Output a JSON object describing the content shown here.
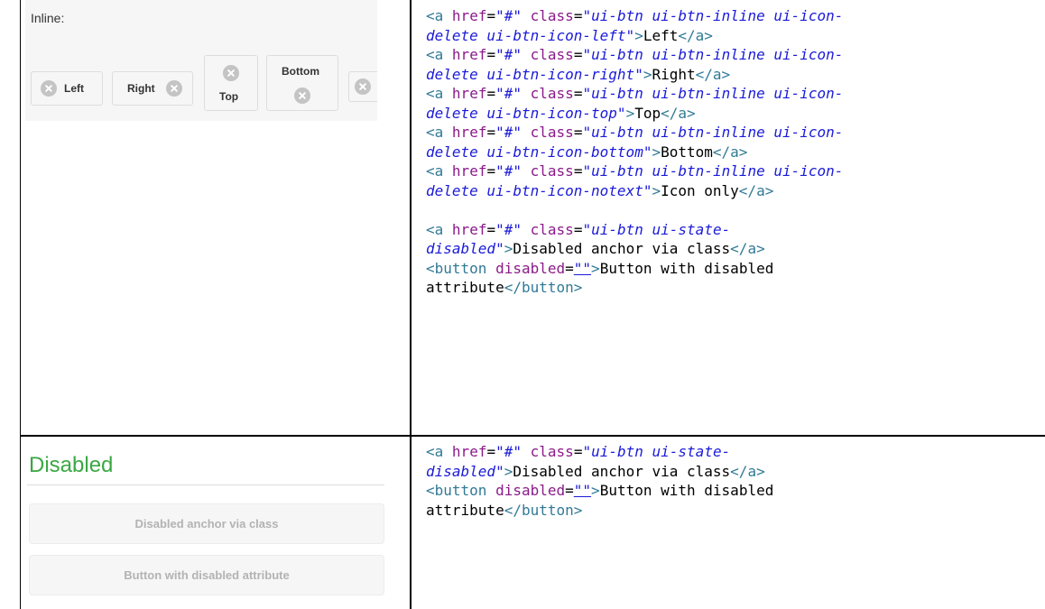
{
  "inline_demo": {
    "label": "Inline:",
    "buttons": {
      "left": "Left",
      "right": "Right",
      "top": "Top",
      "bottom": "Bottom"
    }
  },
  "disabled_demo": {
    "title": "Disabled",
    "anchor_label": "Disabled anchor via class",
    "button_label": "Button with disabled attribute"
  },
  "code_1": {
    "lines": [
      [
        [
          "t",
          "<"
        ],
        [
          "t",
          "a"
        ],
        [
          "x",
          " "
        ],
        [
          "a",
          "href"
        ],
        [
          "x",
          "="
        ],
        [
          "s",
          "\"#\""
        ],
        [
          "x",
          " "
        ],
        [
          "a",
          "class"
        ],
        [
          "x",
          "="
        ],
        [
          "s",
          "\"ui-btn ui-btn-inline ui-icon-"
        ]
      ],
      [
        [
          "s",
          "delete ui-btn-icon-left\""
        ],
        [
          "t",
          ">"
        ],
        [
          "x",
          "Left"
        ],
        [
          "t",
          "</a>"
        ]
      ],
      [
        [
          "t",
          "<"
        ],
        [
          "t",
          "a"
        ],
        [
          "x",
          " "
        ],
        [
          "a",
          "href"
        ],
        [
          "x",
          "="
        ],
        [
          "s",
          "\"#\""
        ],
        [
          "x",
          " "
        ],
        [
          "a",
          "class"
        ],
        [
          "x",
          "="
        ],
        [
          "s",
          "\"ui-btn ui-btn-inline ui-icon-"
        ]
      ],
      [
        [
          "s",
          "delete ui-btn-icon-right\""
        ],
        [
          "t",
          ">"
        ],
        [
          "x",
          "Right"
        ],
        [
          "t",
          "</a>"
        ]
      ],
      [
        [
          "t",
          "<"
        ],
        [
          "t",
          "a"
        ],
        [
          "x",
          " "
        ],
        [
          "a",
          "href"
        ],
        [
          "x",
          "="
        ],
        [
          "s",
          "\"#\""
        ],
        [
          "x",
          " "
        ],
        [
          "a",
          "class"
        ],
        [
          "x",
          "="
        ],
        [
          "s",
          "\"ui-btn ui-btn-inline ui-icon-"
        ]
      ],
      [
        [
          "s",
          "delete ui-btn-icon-top\""
        ],
        [
          "t",
          ">"
        ],
        [
          "x",
          "Top"
        ],
        [
          "t",
          "</a>"
        ]
      ],
      [
        [
          "t",
          "<"
        ],
        [
          "t",
          "a"
        ],
        [
          "x",
          " "
        ],
        [
          "a",
          "href"
        ],
        [
          "x",
          "="
        ],
        [
          "s",
          "\"#\""
        ],
        [
          "x",
          " "
        ],
        [
          "a",
          "class"
        ],
        [
          "x",
          "="
        ],
        [
          "s",
          "\"ui-btn ui-btn-inline ui-icon-"
        ]
      ],
      [
        [
          "s",
          "delete ui-btn-icon-bottom\""
        ],
        [
          "t",
          ">"
        ],
        [
          "x",
          "Bottom"
        ],
        [
          "t",
          "</a>"
        ]
      ],
      [
        [
          "t",
          "<"
        ],
        [
          "t",
          "a"
        ],
        [
          "x",
          " "
        ],
        [
          "a",
          "href"
        ],
        [
          "x",
          "="
        ],
        [
          "s",
          "\"#\""
        ],
        [
          "x",
          " "
        ],
        [
          "a",
          "class"
        ],
        [
          "x",
          "="
        ],
        [
          "s",
          "\"ui-btn ui-btn-inline ui-icon-"
        ]
      ],
      [
        [
          "s",
          "delete ui-btn-icon-notext\""
        ],
        [
          "t",
          ">"
        ],
        [
          "x",
          "Icon only"
        ],
        [
          "t",
          "</a>"
        ]
      ],
      [],
      [
        [
          "t",
          "<"
        ],
        [
          "t",
          "a"
        ],
        [
          "x",
          " "
        ],
        [
          "a",
          "href"
        ],
        [
          "x",
          "="
        ],
        [
          "s",
          "\"#\""
        ],
        [
          "x",
          " "
        ],
        [
          "a",
          "class"
        ],
        [
          "x",
          "="
        ],
        [
          "s",
          "\"ui-btn ui-state-"
        ]
      ],
      [
        [
          "s",
          "disabled\""
        ],
        [
          "t",
          ">"
        ],
        [
          "x",
          "Disabled anchor via class"
        ],
        [
          "t",
          "</a>"
        ]
      ],
      [
        [
          "t",
          "<button"
        ],
        [
          "x",
          " "
        ],
        [
          "a",
          "disabled"
        ],
        [
          "x",
          "="
        ],
        [
          "u",
          "\"\""
        ],
        [
          "t",
          ">"
        ],
        [
          "x",
          "Button with disabled"
        ]
      ],
      [
        [
          "x",
          "attribute"
        ],
        [
          "t",
          "</button>"
        ]
      ]
    ]
  },
  "code_2": {
    "lines": [
      [
        [
          "t",
          "<"
        ],
        [
          "t",
          "a"
        ],
        [
          "x",
          " "
        ],
        [
          "a",
          "href"
        ],
        [
          "x",
          "="
        ],
        [
          "s",
          "\"#\""
        ],
        [
          "x",
          " "
        ],
        [
          "a",
          "class"
        ],
        [
          "x",
          "="
        ],
        [
          "s",
          "\"ui-btn ui-state-"
        ]
      ],
      [
        [
          "s",
          "disabled\""
        ],
        [
          "t",
          ">"
        ],
        [
          "x",
          "Disabled anchor via class"
        ],
        [
          "t",
          "</a>"
        ]
      ],
      [
        [
          "t",
          "<button"
        ],
        [
          "x",
          " "
        ],
        [
          "a",
          "disabled"
        ],
        [
          "x",
          "="
        ],
        [
          "u",
          "\"\""
        ],
        [
          "t",
          ">"
        ],
        [
          "x",
          "Button with disabled"
        ]
      ],
      [
        [
          "x",
          "attribute"
        ],
        [
          "t",
          "</button>"
        ]
      ]
    ]
  }
}
